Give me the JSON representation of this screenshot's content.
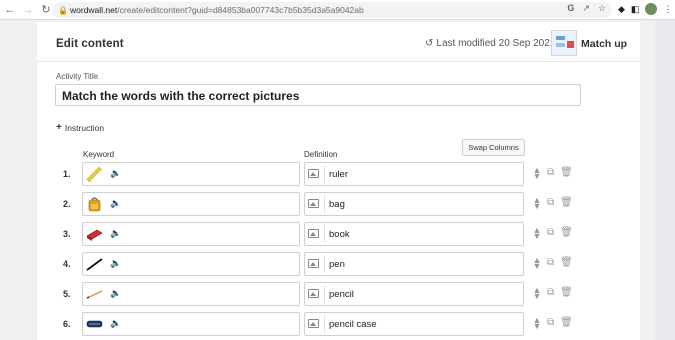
{
  "browser": {
    "url_host": "wordwall.net",
    "url_path": "/create/editcontent?guid=d84853ba007743c7b5b35d3a5a9042ab"
  },
  "header": {
    "title": "Edit content",
    "last_modified": "Last modified 20 Sep 2021",
    "template_name": "Match up"
  },
  "activity": {
    "label": "Activity Title",
    "value": "Match the words with the correct pictures"
  },
  "instruction": {
    "label": "Instruction"
  },
  "swap_button": "Swap Columns",
  "columns": {
    "keyword": "Keyword",
    "definition": "Definition"
  },
  "rows": [
    {
      "num": "1.",
      "picture": "ruler-icon",
      "definition": "ruler"
    },
    {
      "num": "2.",
      "picture": "bag-icon",
      "definition": "bag"
    },
    {
      "num": "3.",
      "picture": "book-icon",
      "definition": "book"
    },
    {
      "num": "4.",
      "picture": "pen-icon",
      "definition": "pen"
    },
    {
      "num": "5.",
      "picture": "pencil-icon",
      "definition": "pencil"
    },
    {
      "num": "6.",
      "picture": "pencil-case-icon",
      "definition": "pencil case"
    }
  ]
}
